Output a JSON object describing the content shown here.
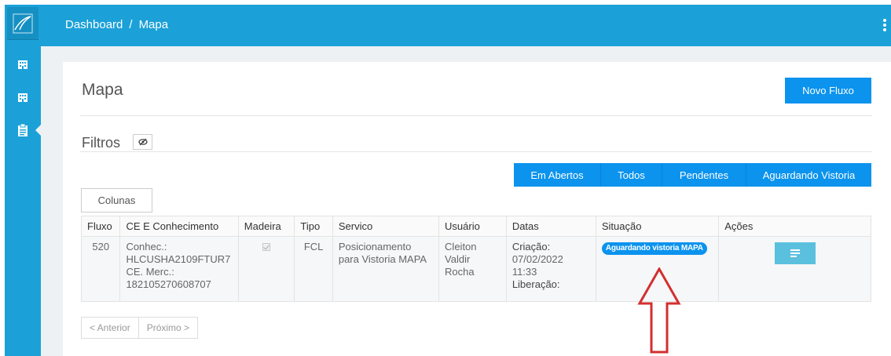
{
  "breadcrumb": {
    "home": "Dashboard",
    "separator": "/",
    "current": "Mapa"
  },
  "sidebar": {
    "items": [
      {
        "icon": "building-icon"
      },
      {
        "icon": "building-icon"
      },
      {
        "icon": "clipboard-icon",
        "active": true
      }
    ]
  },
  "page": {
    "title": "Mapa",
    "new_button": "Novo Fluxo"
  },
  "filters": {
    "label": "Filtros",
    "toggle_icon": "eye-slash-icon",
    "buttons": [
      "Em Abertos",
      "Todos",
      "Pendentes",
      "Aguardando Vistoria"
    ]
  },
  "columns_button": "Colunas",
  "table": {
    "headers": [
      "Fluxo",
      "CE E Conhecimento",
      "Madeira",
      "Tipo",
      "Servico",
      "Usuário",
      "Datas",
      "Situação",
      "Ações"
    ],
    "rows": [
      {
        "fluxo": "520",
        "ce_lines": [
          "Conhec.:",
          "HLCUSHA2109FTUR7",
          "CE. Merc.:",
          "182105270608707"
        ],
        "madeira_checked": true,
        "tipo": "FCL",
        "servico_lines": [
          "Posicionamento",
          "para Vistoria MAPA"
        ],
        "usuario_lines": [
          "Cleiton",
          "Valdir Rocha"
        ],
        "criacao_label": "Criação:",
        "criacao_value": "07/02/2022 11:33",
        "liberacao_label": "Liberação:",
        "situacao": "Aguardando vistoria MAPA"
      }
    ]
  },
  "pagination": {
    "prev": "< Anterior",
    "next": "Próximo >"
  },
  "colors": {
    "brand": "#1ba1d8",
    "primary_button": "#0b93ee",
    "info_button": "#5bc0de",
    "annotation_arrow": "#d32f2f"
  }
}
